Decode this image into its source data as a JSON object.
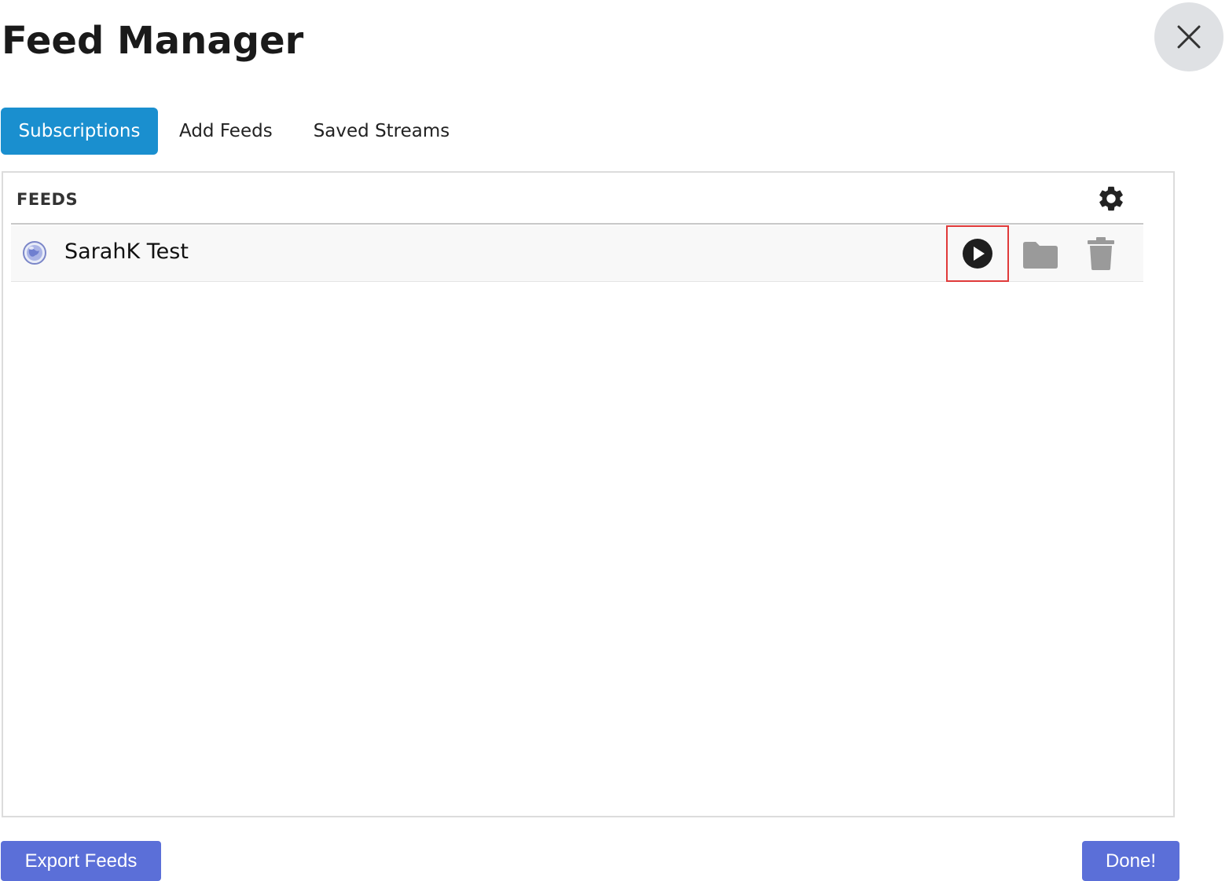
{
  "header": {
    "title": "Feed Manager"
  },
  "icons": {
    "close": "close-icon",
    "settings": "gear-icon",
    "feed_type": "globe-icon",
    "play": "play-circle-icon",
    "folder": "folder-icon",
    "delete": "trash-icon"
  },
  "tabs": [
    {
      "label": "Subscriptions",
      "active": true
    },
    {
      "label": "Add Feeds",
      "active": false
    },
    {
      "label": "Saved Streams",
      "active": false
    }
  ],
  "panel": {
    "section_label": "FEEDS",
    "feeds": [
      {
        "name": "SarahK Test"
      }
    ]
  },
  "footer": {
    "export_label": "Export Feeds",
    "done_label": "Done!"
  },
  "colors": {
    "active_tab": "#1a8fcf",
    "primary_button": "#5b6fd8",
    "highlight_border": "#e03a3a"
  }
}
